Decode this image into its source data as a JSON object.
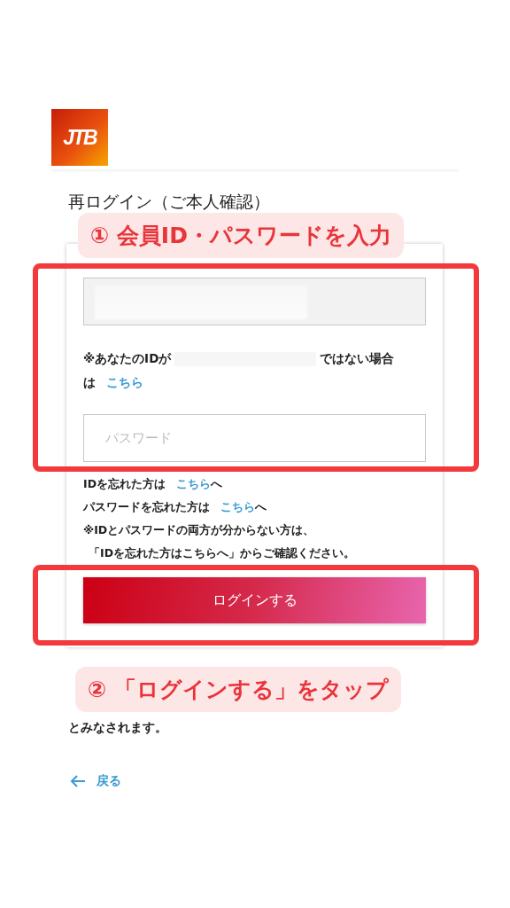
{
  "logo": {
    "text": "JTB"
  },
  "heading": "再ログイン（ご本人確認）",
  "id_field": {
    "disabled": true
  },
  "id_notice": {
    "before": "※あなたのIDが",
    "after": "ではない場合",
    "wrap": "は",
    "link": "こちら"
  },
  "password_field": {
    "placeholder": "パスワード"
  },
  "help_links": [
    {
      "text": "IDを忘れた方は",
      "link": "こちら",
      "suffix": "へ"
    },
    {
      "text": "パスワードを忘れた方は",
      "link": "こちら",
      "suffix": "へ"
    }
  ],
  "help_notes": [
    "※IDとパスワードの両方が分からない方は、",
    "「IDを忘れた方はこちらへ」からご確認ください。"
  ],
  "login_button": "ログインする",
  "footer_text": "とみなされます。",
  "back_link": "戻る",
  "annotations": [
    {
      "label": "① 会員ID・パスワードを入力"
    },
    {
      "label": "② 「ログインする」をタップ"
    }
  ]
}
